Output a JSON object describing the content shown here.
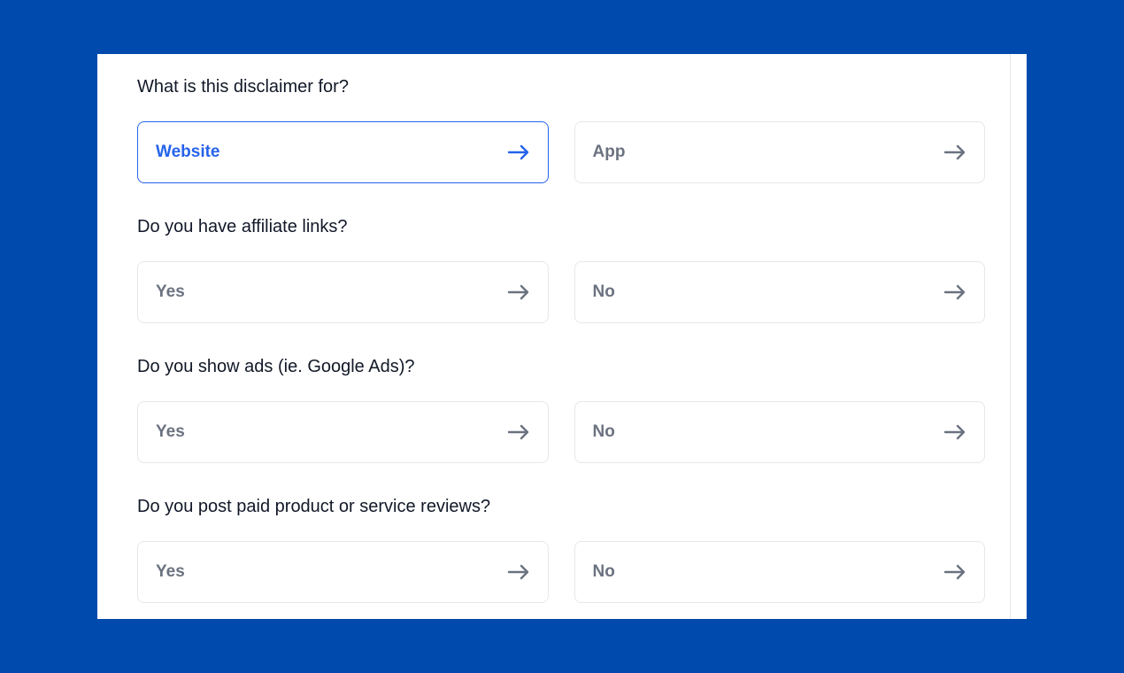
{
  "questions": [
    {
      "text": "What is this disclaimer for?",
      "options": [
        {
          "label": "Website",
          "selected": true
        },
        {
          "label": "App",
          "selected": false
        }
      ]
    },
    {
      "text": "Do you have affiliate links?",
      "options": [
        {
          "label": "Yes",
          "selected": false
        },
        {
          "label": "No",
          "selected": false
        }
      ]
    },
    {
      "text": "Do you show ads (ie. Google Ads)?",
      "options": [
        {
          "label": "Yes",
          "selected": false
        },
        {
          "label": "No",
          "selected": false
        }
      ]
    },
    {
      "text": "Do you post paid product or service reviews?",
      "options": [
        {
          "label": "Yes",
          "selected": false
        },
        {
          "label": "No",
          "selected": false
        }
      ]
    }
  ],
  "colors": {
    "background": "#004aad",
    "accent": "#2563eb",
    "muted": "#6b7280",
    "text": "#111827"
  },
  "icons": {
    "option_arrow": "arrow-right-icon"
  }
}
